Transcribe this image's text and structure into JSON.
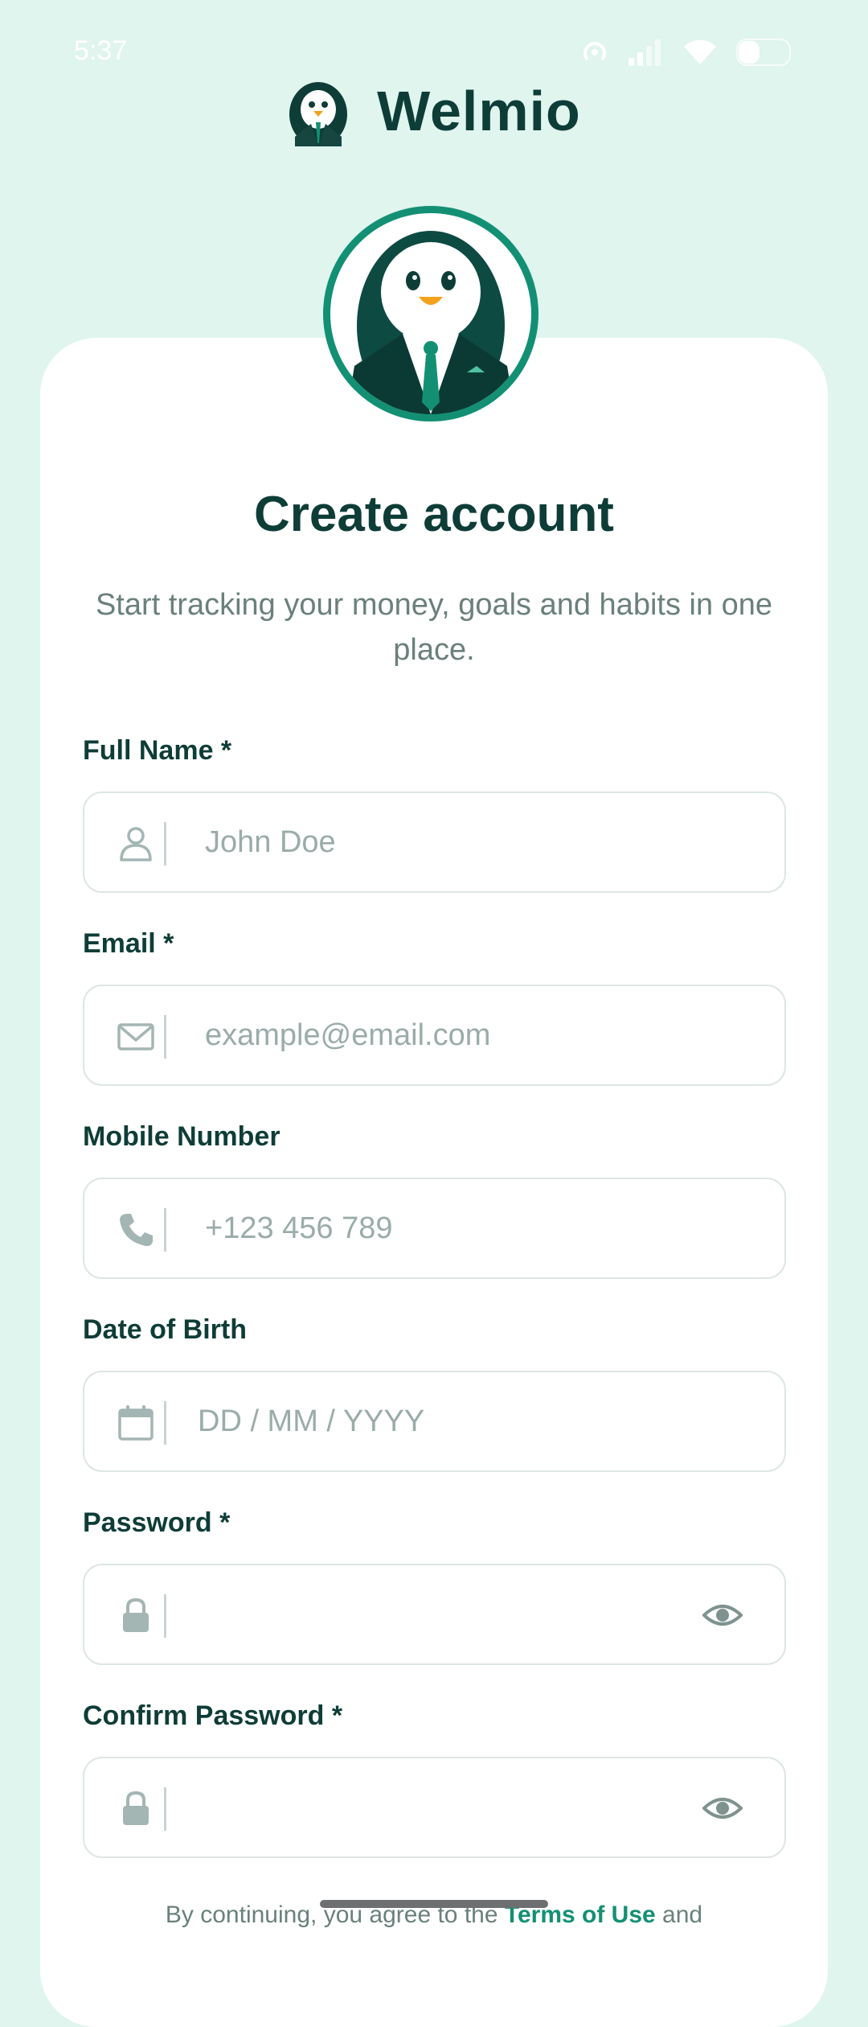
{
  "status_bar": {
    "time": "5:37"
  },
  "brand": {
    "name": "Welmio"
  },
  "header": {
    "title": "Create account",
    "subtitle": "Start tracking your money, goals and habits in one place."
  },
  "form": {
    "full_name": {
      "label": "Full Name *",
      "placeholder": "John Doe",
      "icon": "user-icon"
    },
    "email": {
      "label": "Email *",
      "placeholder": "example@email.com",
      "icon": "mail-icon"
    },
    "mobile": {
      "label": "Mobile Number",
      "placeholder": "+123 456 789",
      "icon": "phone-icon"
    },
    "dob": {
      "label": "Date of Birth",
      "placeholder": "DD / MM / YYYY",
      "icon": "calendar-icon"
    },
    "password": {
      "label": "Password *",
      "placeholder": "",
      "icon": "lock-icon"
    },
    "confirm_password": {
      "label": "Confirm Password *",
      "placeholder": "",
      "icon": "lock-icon"
    }
  },
  "terms": {
    "prefix": "By continuing, you agree to the ",
    "link": "Terms of Use",
    "suffix": " and"
  },
  "colors": {
    "accent": "#139074",
    "text_dark": "#0e3d37",
    "background": "#dff5ee"
  }
}
